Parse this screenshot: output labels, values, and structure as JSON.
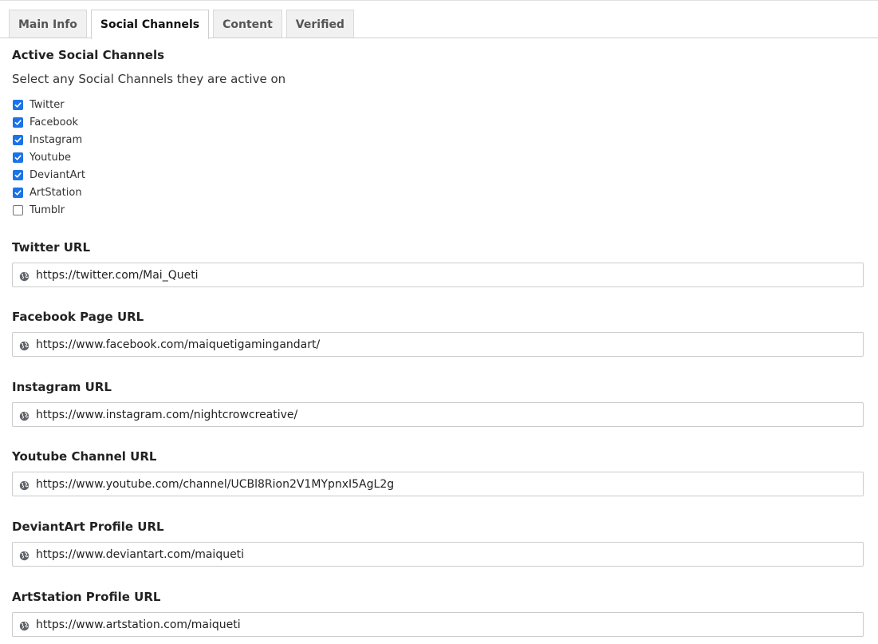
{
  "tabs": [
    {
      "label": "Main Info",
      "active": false
    },
    {
      "label": "Social Channels",
      "active": true
    },
    {
      "label": "Content",
      "active": false
    },
    {
      "label": "Verified",
      "active": false
    }
  ],
  "section": {
    "title": "Active Social Channels",
    "description": "Select any Social Channels they are active on"
  },
  "channels": [
    {
      "label": "Twitter",
      "checked": true
    },
    {
      "label": "Facebook",
      "checked": true
    },
    {
      "label": "Instagram",
      "checked": true
    },
    {
      "label": "Youtube",
      "checked": true
    },
    {
      "label": "DeviantArt",
      "checked": true
    },
    {
      "label": "ArtStation",
      "checked": true
    },
    {
      "label": "Tumblr",
      "checked": false
    }
  ],
  "fields": [
    {
      "label": "Twitter URL",
      "value": "https://twitter.com/Mai_Queti"
    },
    {
      "label": "Facebook Page URL",
      "value": "https://www.facebook.com/maiquetigamingandart/"
    },
    {
      "label": "Instagram URL",
      "value": "https://www.instagram.com/nightcrowcreative/"
    },
    {
      "label": "Youtube Channel URL",
      "value": "https://www.youtube.com/channel/UCBl8Rion2V1MYpnxI5AgL2g"
    },
    {
      "label": "DeviantArt Profile URL",
      "value": "https://www.deviantart.com/maiqueti"
    },
    {
      "label": "ArtStation Profile URL",
      "value": "https://www.artstation.com/maiqueti"
    }
  ],
  "icons": {
    "checkbox_check": "check-icon",
    "field_prefix": "globe-icon"
  },
  "colors": {
    "checkbox_checked": "#1a73e8",
    "tab_inactive_bg": "#f1f1f1",
    "border": "#cccccc"
  }
}
